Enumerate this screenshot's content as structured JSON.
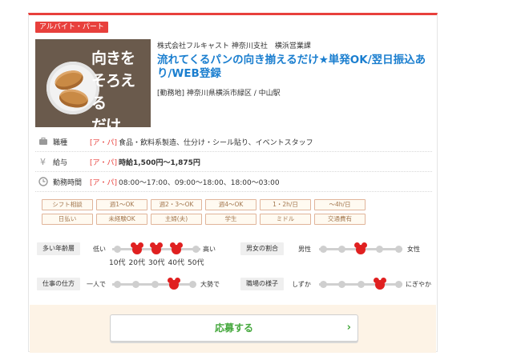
{
  "badge": "アルバイト・パート",
  "thumbnail": {
    "caption": "向きを\nそろえる\nだけ",
    "image": "bread-on-plate"
  },
  "company": "株式会社フルキャスト 神奈川支社　横浜営業課",
  "title": "流れてくるパンの向き揃えるだけ★単発OK/翌日振込あり/WEB登録",
  "location": "[勤務地] 神奈川県横浜市緑区 / 中山駅",
  "details": [
    {
      "icon": "briefcase-icon",
      "label": "職種",
      "tag": "[ア・パ]",
      "value": "食品・飲料系製造、仕分け・シール貼り、イベントスタッフ",
      "bold": false
    },
    {
      "icon": "yen-icon",
      "label": "給与",
      "tag": "[ア・パ]",
      "value": "時給1,500円～1,875円",
      "bold": true
    },
    {
      "icon": "clock-icon",
      "label": "勤務時間",
      "tag": "[ア・パ]",
      "value": "08:00～17:00、09:00～18:00、18:00～03:00",
      "bold": false
    }
  ],
  "features": [
    "シフト相談",
    "週1～OK",
    "週2・3～OK",
    "週4～OK",
    "1・2h/日",
    "～4h/日",
    "日払い",
    "未経験OK",
    "主婦(夫)",
    "学生",
    "ミドル",
    "交通費有"
  ],
  "scales": {
    "age": {
      "label": "多い年齢層",
      "low": "低い",
      "high": "高い",
      "ticks": [
        "10代",
        "20代",
        "30代",
        "40代",
        "50代"
      ],
      "selected": [
        1,
        2,
        3
      ]
    },
    "gender": {
      "label": "男女の割合",
      "low": "男性",
      "high": "女性",
      "selected": [
        2
      ]
    },
    "work_style": {
      "label": "仕事の仕方",
      "low": "一人で",
      "high": "大勢で",
      "selected": [
        3
      ]
    },
    "atmosphere": {
      "label": "職場の様子",
      "low": "しずか",
      "high": "にぎやか",
      "selected": [
        3
      ]
    }
  },
  "apply": {
    "label": "応募する",
    "chevron": "›"
  },
  "colors": {
    "accent": "#e8403c",
    "link": "#1a7ecf",
    "apply_text": "#45a83d",
    "marker": "#e02020"
  }
}
